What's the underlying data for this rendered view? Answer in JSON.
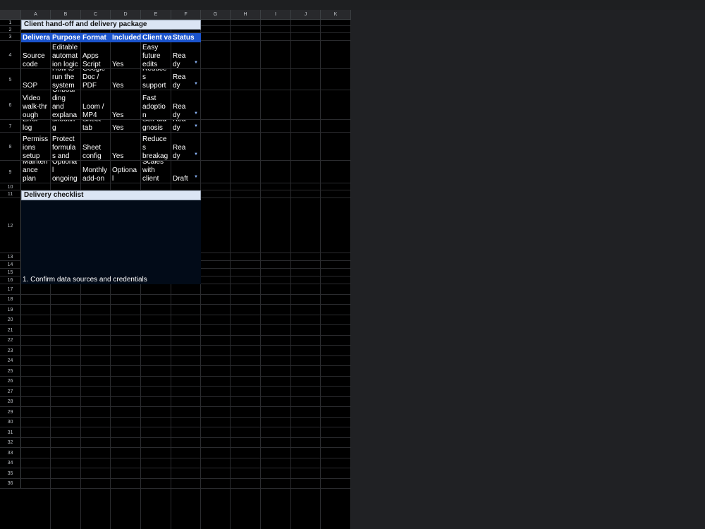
{
  "columns": [
    "A",
    "B",
    "C",
    "D",
    "E",
    "F",
    "G",
    "H",
    "I",
    "J",
    "K"
  ],
  "row_numbers": [
    "1",
    "2",
    "3",
    "4",
    "5",
    "6",
    "7",
    "8",
    "9",
    "10",
    "11",
    "12",
    "13",
    "14",
    "15",
    "16",
    "17",
    "18",
    "19",
    "20",
    "21",
    "22",
    "23",
    "24",
    "25",
    "26",
    "27",
    "28",
    "29",
    "30",
    "31",
    "32",
    "33",
    "34",
    "35",
    "36"
  ],
  "title": "Client hand-off and delivery package",
  "headers": [
    "Delivera",
    "Purpose",
    "Format",
    "Included",
    "Client va",
    "Status"
  ],
  "rows": [
    [
      "Source\ncode",
      "Editable\nautomat\nion logic",
      "Apps\nScript",
      "Yes",
      "Easy\nfuture\nedits",
      "Rea\ndy"
    ],
    [
      "SOP",
      "How to\nrun the\nsystem",
      "Google\nDoc /\nPDF",
      "Yes",
      "Reduce\ns\nsupport",
      "Rea\ndy"
    ],
    [
      "Video\nwalk-thr\nough",
      "Onboar\nding\nand\nexplana",
      "Loom /\nMP4",
      "Yes",
      "Fast\nadoptio\nn",
      "Rea\ndy"
    ],
    [
      "Error\nlog",
      "Trouble\nshootin\ng",
      "Sheet\ntab",
      "Yes",
      "Self-dia\ngnosis",
      "Rea\ndy"
    ],
    [
      "Permiss\nions\nsetup",
      "Protect\nformula\ns and",
      "Sheet\nconfig",
      "Yes",
      "Reduce\ns\nbreakag",
      "Rea\ndy"
    ],
    [
      "Mainten\nance\nplan",
      "Optiona\nl\nongoing",
      "Monthly\nadd-on",
      "Optiona\nl",
      "Scales\nwith\nclient",
      "Draft"
    ]
  ],
  "checklist_title": "Delivery checklist",
  "checklist_item": "1. Confirm data sources and credentials",
  "dropdown_icon": "chevron-down-icon"
}
